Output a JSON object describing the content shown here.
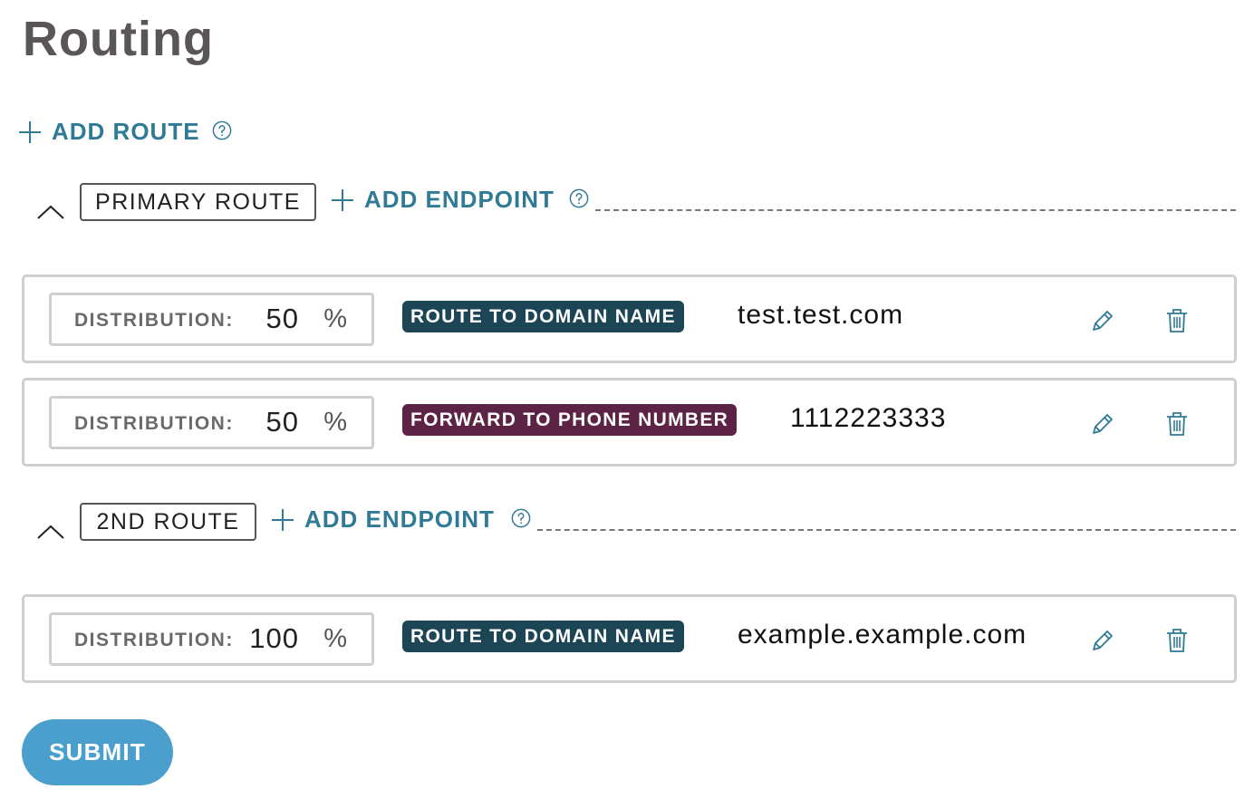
{
  "page": {
    "title": "Routing"
  },
  "add_route": {
    "label": "ADD ROUTE"
  },
  "routes": [
    {
      "name": "PRIMARY ROUTE",
      "add_endpoint_label": "ADD ENDPOINT",
      "endpoints": [
        {
          "distribution_label": "DISTRIBUTION:",
          "distribution_value": "50",
          "distribution_unit": "%",
          "type_label": "ROUTE TO DOMAIN NAME",
          "type_color": "#1c4556",
          "value": "test.test.com"
        },
        {
          "distribution_label": "DISTRIBUTION:",
          "distribution_value": "50",
          "distribution_unit": "%",
          "type_label": "FORWARD TO PHONE NUMBER",
          "type_color": "#5c2344",
          "value": "1112223333"
        }
      ]
    },
    {
      "name": "2ND ROUTE",
      "add_endpoint_label": "ADD ENDPOINT",
      "endpoints": [
        {
          "distribution_label": "DISTRIBUTION:",
          "distribution_value": "100",
          "distribution_unit": "%",
          "type_label": "ROUTE TO DOMAIN NAME",
          "type_color": "#1c4556",
          "value": "example.example.com"
        }
      ]
    }
  ],
  "submit": {
    "label": "SUBMIT"
  },
  "icons": {
    "add": "plus-icon",
    "help": "question-circle-icon",
    "collapse": "chevron-up-icon",
    "edit": "pencil-icon",
    "delete": "trash-icon"
  },
  "colors": {
    "accent": "#2f7a96",
    "title": "#5a5558",
    "submit": "#4a9fcc",
    "domain_badge": "#1c4556",
    "phone_badge": "#5c2344"
  }
}
